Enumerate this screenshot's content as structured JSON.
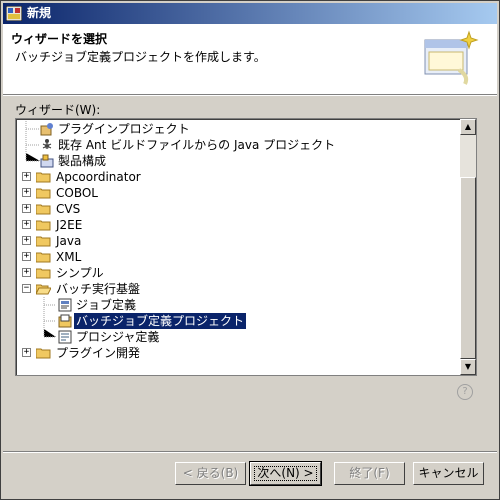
{
  "window": {
    "title": "新規"
  },
  "header": {
    "title": "ウィザードを選択",
    "description": "バッチジョブ定義プロジェクトを作成します。"
  },
  "tree": {
    "label": "ウィザード(W):",
    "items": [
      {
        "label": "プラグインプロジェクト",
        "selected": false
      },
      {
        "label": "既存 Ant ビルドファイルからの Java プロジェクト",
        "selected": false
      },
      {
        "label": "製品構成",
        "selected": false
      },
      {
        "label": "Apcoordinator",
        "selected": false
      },
      {
        "label": "COBOL",
        "selected": false
      },
      {
        "label": "CVS",
        "selected": false
      },
      {
        "label": "J2EE",
        "selected": false
      },
      {
        "label": "Java",
        "selected": false
      },
      {
        "label": "XML",
        "selected": false
      },
      {
        "label": "シンプル",
        "selected": false
      },
      {
        "label": "バッチ実行基盤",
        "selected": false
      },
      {
        "label": "ジョブ定義",
        "selected": false
      },
      {
        "label": "バッチジョブ定義プロジェクト",
        "selected": true
      },
      {
        "label": "プロシジャ定義",
        "selected": false
      },
      {
        "label": "プラグイン開発",
        "selected": false
      }
    ]
  },
  "buttons": {
    "back": "< 戻る(B)",
    "next": "次へ(N) >",
    "finish": "終了(F)",
    "cancel": "キャンセル"
  },
  "icons": {
    "help": "help-icon",
    "folder": "folder-icon"
  }
}
